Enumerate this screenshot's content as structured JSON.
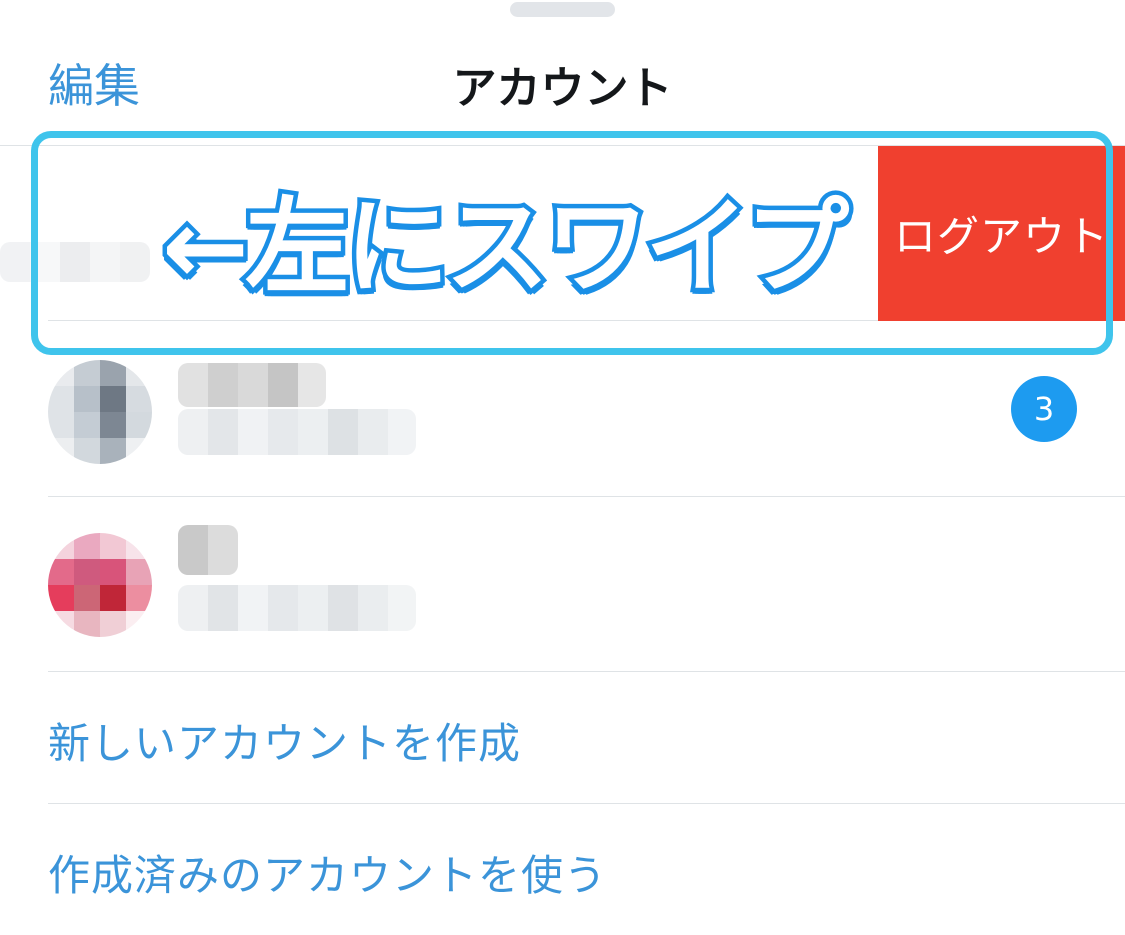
{
  "header": {
    "edit_label": "編集",
    "title": "アカウント"
  },
  "swiped_row": {
    "logout_label": "ログアウト"
  },
  "annotation": {
    "hint_text": "←左にスワイプ",
    "hint_color": "#1a8fe6",
    "box_color": "#3fc4ec"
  },
  "accounts": [
    {
      "avatar": "avatar-gray",
      "unread_badge": "3"
    },
    {
      "avatar": "avatar-pink",
      "unread_badge": ""
    }
  ],
  "actions": {
    "create_account": "新しいアカウントを作成",
    "use_existing": "作成済みのアカウントを使う"
  },
  "colors": {
    "accent": "#3b94d9",
    "logout": "#f0402f",
    "badge": "#1d9bf0"
  }
}
